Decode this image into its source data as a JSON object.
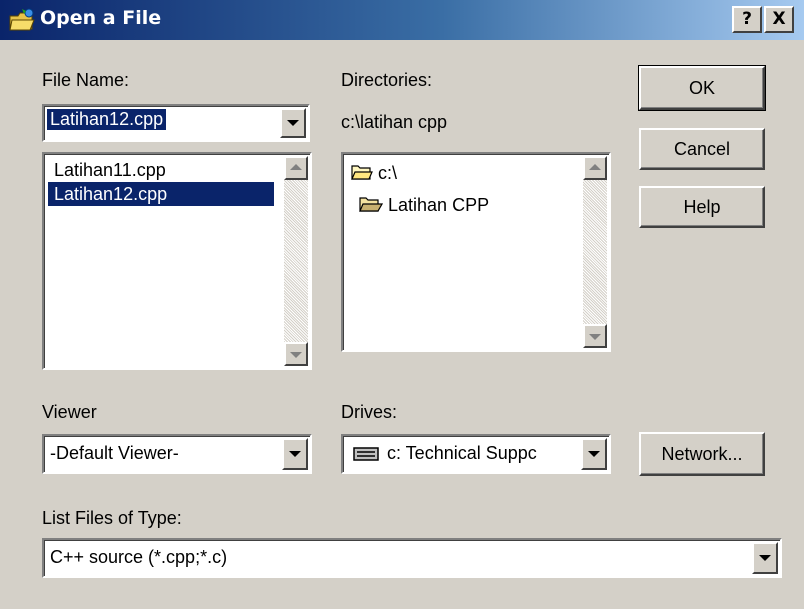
{
  "window": {
    "title": "Open a File",
    "help_button": "?",
    "close_button": "X"
  },
  "file_name": {
    "label": "File Name:",
    "value": "Latihan12.cpp",
    "files": [
      "Latihan11.cpp",
      "Latihan12.cpp"
    ],
    "selected_file": "Latihan12.cpp"
  },
  "directories": {
    "label": "Directories:",
    "current_path": "c:\\latihan cpp",
    "items": [
      {
        "name": "c:\\",
        "icon": "open-folder-icon"
      },
      {
        "name": "Latihan CPP",
        "icon": "open-folder-icon"
      }
    ]
  },
  "buttons": {
    "ok": "OK",
    "cancel": "Cancel",
    "help": "Help",
    "network": "Network..."
  },
  "viewer": {
    "label": "Viewer",
    "value": "-Default Viewer-"
  },
  "drives": {
    "label": "Drives:",
    "value": "c: Technical Suppc",
    "icon": "drive-icon"
  },
  "file_type": {
    "label": "List Files of Type:",
    "value": "C++ source (*.cpp;*.c)"
  },
  "colors": {
    "face": "#d4d0c8",
    "selection": "#0a246a",
    "title_gradient_start": "#0a246a",
    "title_gradient_end": "#a6caf0"
  }
}
